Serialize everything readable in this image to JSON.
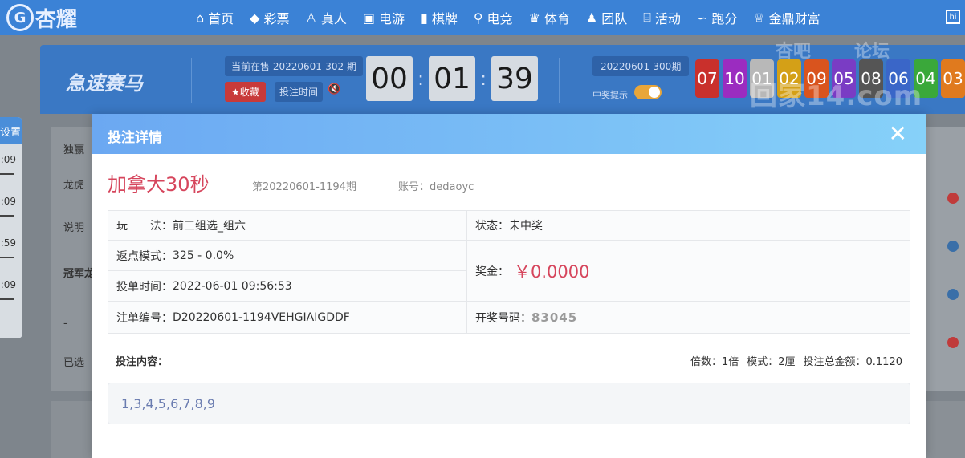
{
  "app": {
    "logo_text": "杏耀"
  },
  "nav": {
    "items": [
      {
        "icon": "⌂",
        "label": "首页",
        "icon_name": "home-icon"
      },
      {
        "icon": "◆",
        "label": "彩票",
        "icon_name": "diamond-icon"
      },
      {
        "icon": "♙",
        "label": "真人",
        "icon_name": "person-icon"
      },
      {
        "icon": "▣",
        "label": "电游",
        "icon_name": "slot-icon"
      },
      {
        "icon": "▮",
        "label": "棋牌",
        "icon_name": "card-icon"
      },
      {
        "icon": "⚲",
        "label": "电竞",
        "icon_name": "gamepad-icon"
      },
      {
        "icon": "♛",
        "label": "体育",
        "icon_name": "trophy-icon"
      },
      {
        "icon": "♟",
        "label": "团队",
        "icon_name": "team-icon"
      },
      {
        "icon": "⌸",
        "label": "活动",
        "icon_name": "gift-icon"
      },
      {
        "icon": "∽",
        "label": "跑分",
        "icon_name": "run-icon"
      },
      {
        "icon": "♕",
        "label": "金鼎财富",
        "icon_name": "crown-icon"
      }
    ],
    "extra": "hi"
  },
  "game_header": {
    "logo": "急速赛马",
    "current_issue": "当前在售 20220601-302 期",
    "fav_label": "★收藏",
    "time_label": "投注时间",
    "countdown": [
      "00",
      "01",
      "39"
    ],
    "prev_issue": "20220601-300期",
    "win_hint": "中奖提示",
    "balls": [
      {
        "n": "07",
        "c": "#c9302c"
      },
      {
        "n": "10",
        "c": "#9b2cc0"
      },
      {
        "n": "01",
        "c": "#b8b8b8"
      },
      {
        "n": "02",
        "c": "#d4a017"
      },
      {
        "n": "09",
        "c": "#d9541e"
      },
      {
        "n": "05",
        "c": "#7a3cc4"
      },
      {
        "n": "08",
        "c": "#555555"
      },
      {
        "n": "06",
        "c": "#3a66c8"
      },
      {
        "n": "04",
        "c": "#3aa83a"
      },
      {
        "n": "03",
        "c": "#e07a1e"
      }
    ]
  },
  "watermark": {
    "line1": "杏吧",
    "line2": "论坛",
    "line3": "回家14.com"
  },
  "background": {
    "left_head": "设置",
    "left_times": [
      ":09",
      ":09",
      ":59",
      ":09"
    ],
    "side_labels": [
      "独赢",
      "龙虎",
      "说明",
      "冠军龙",
      "-",
      "已选"
    ]
  },
  "modal": {
    "title": "投注详情",
    "close": "✕",
    "game_name": "加拿大30秒",
    "issue": "第20220601-1194期",
    "account_label": "账号：",
    "account_value": "dedaoyc",
    "play_label": "玩　　法：",
    "play_value": "前三组选_组六",
    "status_label": "状态：",
    "status_value": "未中奖",
    "rebate_label": "返点模式：",
    "rebate_value": "325 - 0.0%",
    "prize_label": "奖金：",
    "prize_value": "￥0.0000",
    "bet_time_label": "投单时间：",
    "bet_time_value": "2022-06-01 09:56:53",
    "order_label": "注单编号：",
    "order_value": "D20220601-1194VEHGIAIGDDF",
    "draw_label": "开奖号码：",
    "draw_value": "83045",
    "bet_content_label": "投注内容：",
    "multiple": "倍数：1倍",
    "mode": "模式：2厘",
    "total": "投注总金额：0.1120",
    "bet_numbers": "1,3,4,5,6,7,8,9"
  }
}
